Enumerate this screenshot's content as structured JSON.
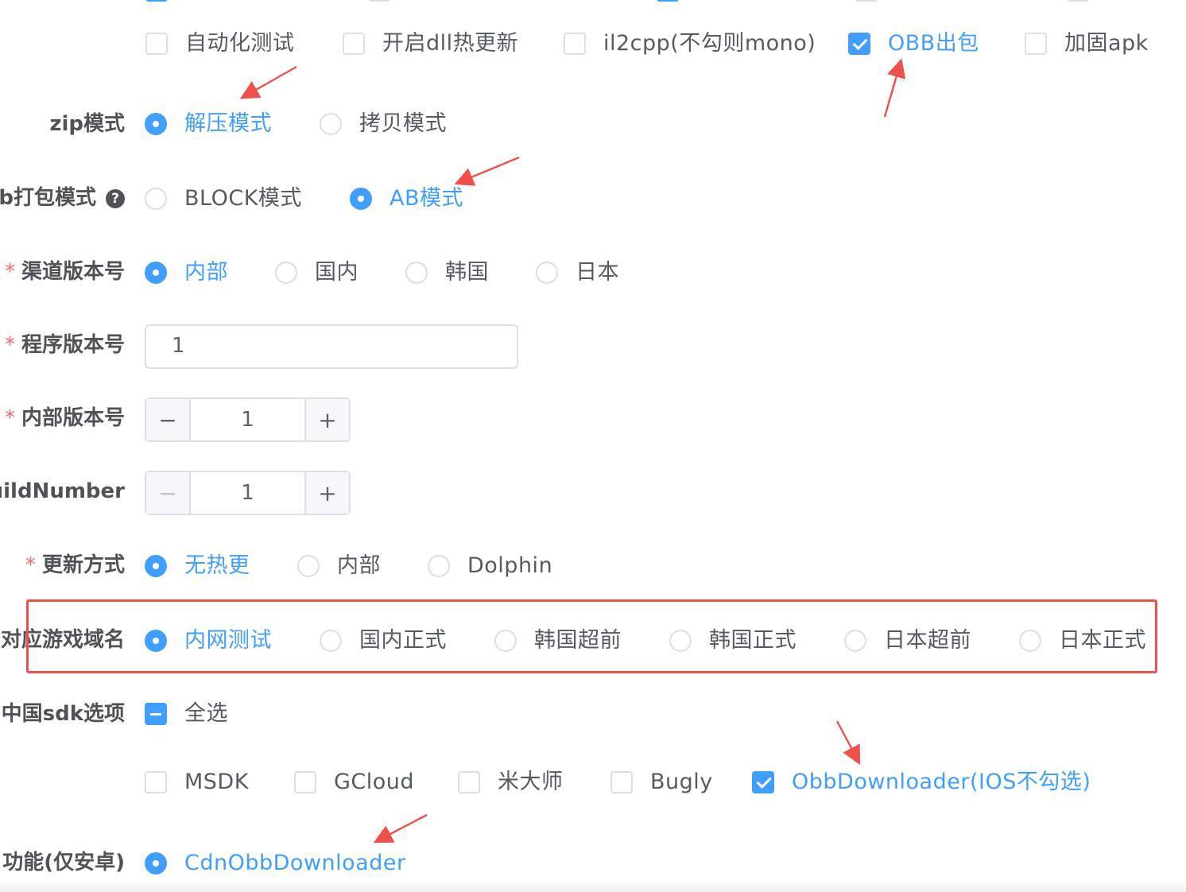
{
  "checkbox_row": {
    "items": [
      {
        "label": "自动化测试",
        "checked": false
      },
      {
        "label": "开启dll热更新",
        "checked": false
      },
      {
        "label": "il2cpp(不勾则mono)",
        "checked": false
      },
      {
        "label": "OBB出包",
        "checked": true
      },
      {
        "label": "加固apk",
        "checked": false
      }
    ]
  },
  "zip_mode": {
    "label": "zip模式",
    "options": [
      {
        "label": "解压模式",
        "selected": true
      },
      {
        "label": "拷贝模式",
        "selected": false
      }
    ]
  },
  "pack_mode": {
    "label": "b打包模式",
    "help_glyph": "?",
    "options": [
      {
        "label": "BLOCK模式",
        "selected": false
      },
      {
        "label": "AB模式",
        "selected": true
      }
    ]
  },
  "channel_version": {
    "required_mark": "*",
    "label": "渠道版本号",
    "options": [
      {
        "label": "内部",
        "selected": true
      },
      {
        "label": "国内",
        "selected": false
      },
      {
        "label": "韩国",
        "selected": false
      },
      {
        "label": "日本",
        "selected": false
      }
    ]
  },
  "program_version": {
    "required_mark": "*",
    "label": "程序版本号",
    "value": "1"
  },
  "internal_version": {
    "required_mark": "*",
    "label": "内部版本号",
    "value": "1",
    "minus": "−",
    "plus": "+"
  },
  "build_number": {
    "label": "buildNumber",
    "value": "1",
    "minus": "−",
    "plus": "+"
  },
  "update_mode": {
    "required_mark": "*",
    "label": "更新方式",
    "options": [
      {
        "label": "无热更",
        "selected": true
      },
      {
        "label": "内部",
        "selected": false
      },
      {
        "label": "Dolphin",
        "selected": false
      }
    ]
  },
  "game_domain": {
    "label": "对应游戏域名",
    "options": [
      {
        "label": "内网测试",
        "selected": true
      },
      {
        "label": "国内正式",
        "selected": false
      },
      {
        "label": "韩国超前",
        "selected": false
      },
      {
        "label": "韩国正式",
        "selected": false
      },
      {
        "label": "日本超前",
        "selected": false
      },
      {
        "label": "日本正式",
        "selected": false
      }
    ]
  },
  "china_sdk": {
    "label": "中国sdk选项",
    "select_all": {
      "label": "全选",
      "state": "indeterminate"
    },
    "items": [
      {
        "label": "MSDK",
        "checked": false
      },
      {
        "label": "GCloud",
        "checked": false
      },
      {
        "label": "米大师",
        "checked": false
      },
      {
        "label": "Bugly",
        "checked": false
      },
      {
        "label": "ObbDownloader(IOS不勾选)",
        "checked": true
      }
    ]
  },
  "extra_feature": {
    "label": "功能(仅安卓)",
    "options": [
      {
        "label": "CdnObbDownloader",
        "selected": true
      }
    ]
  },
  "colors": {
    "accent": "#409eff",
    "annotation": "#f0504a",
    "required": "#f56c6c"
  }
}
